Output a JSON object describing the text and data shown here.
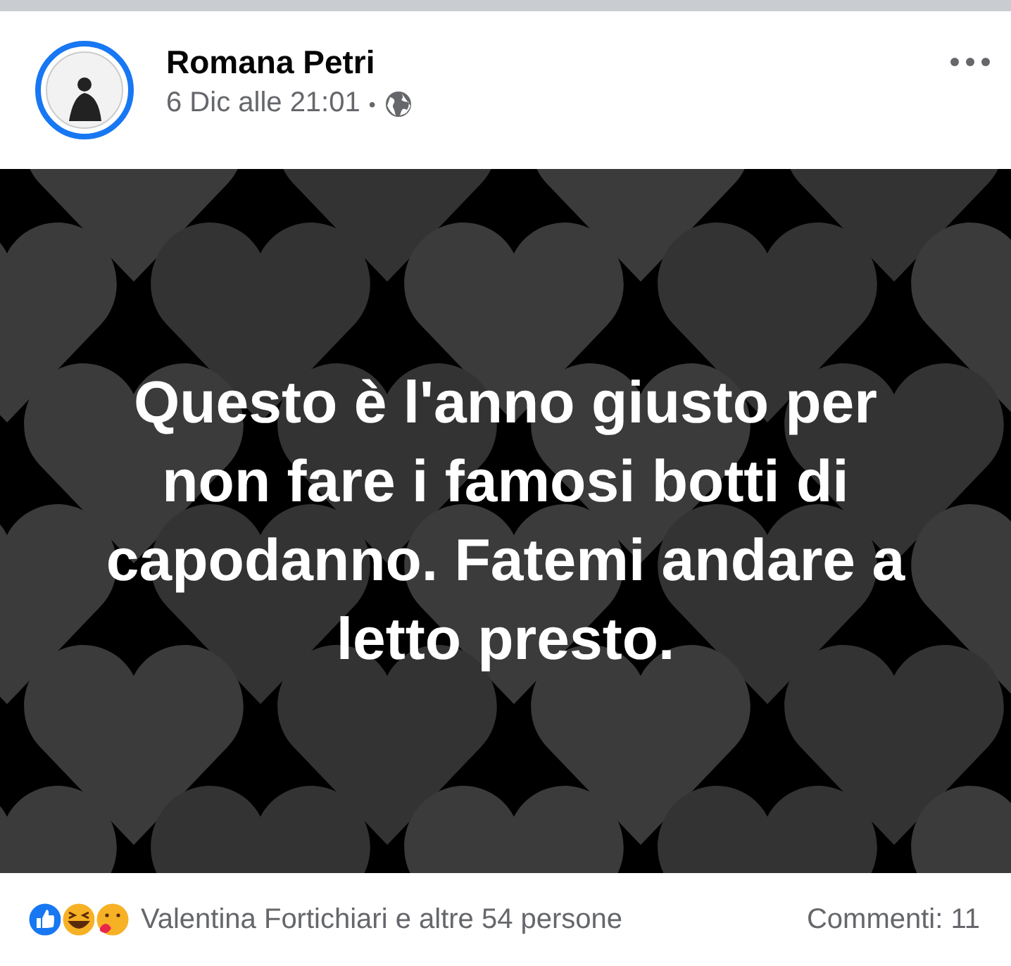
{
  "post": {
    "author": "Romana Petri",
    "time": "6 Dic alle 21:01",
    "separator": "•",
    "image_text": "Questo è l'anno giusto per non fare i famosi botti di capodanno. Fatemi andare a letto presto.",
    "reactions_text": "Valentina Fortichiari e altre 54 persone",
    "comments": "Commenti: 11"
  }
}
